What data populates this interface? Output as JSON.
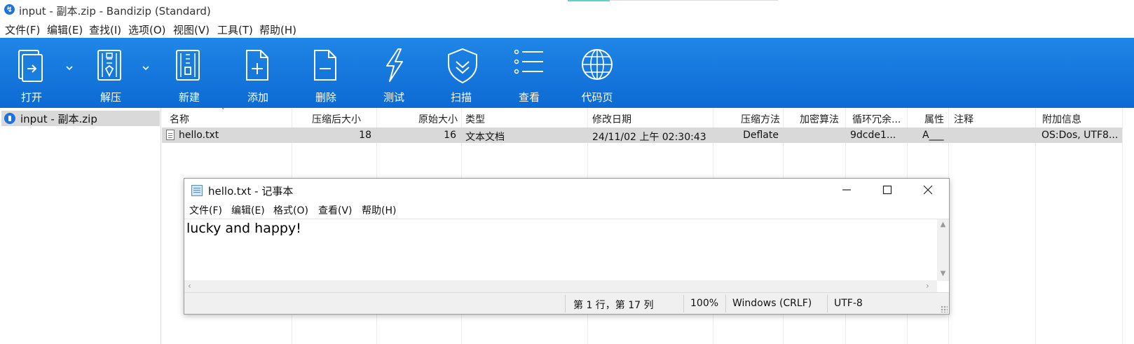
{
  "window": {
    "title": "input - 副本.zip - Bandizip (Standard)"
  },
  "menu": [
    "文件(F)",
    "编辑(E)",
    "查找(I)",
    "选项(O)",
    "视图(V)",
    "工具(T)",
    "帮助(H)"
  ],
  "toolbar": [
    {
      "label": "打开",
      "icon": "open-icon",
      "dropdown": true
    },
    {
      "label": "解压",
      "icon": "extract-icon",
      "dropdown": true
    },
    {
      "label": "新建",
      "icon": "new-archive-icon",
      "dropdown": false
    },
    {
      "label": "添加",
      "icon": "add-file-icon",
      "dropdown": false
    },
    {
      "label": "删除",
      "icon": "delete-file-icon",
      "dropdown": false
    },
    {
      "label": "测试",
      "icon": "test-icon",
      "dropdown": false
    },
    {
      "label": "扫描",
      "icon": "scan-shield-icon",
      "dropdown": false
    },
    {
      "label": "查看",
      "icon": "view-list-icon",
      "dropdown": false
    },
    {
      "label": "代码页",
      "icon": "codepage-globe-icon",
      "dropdown": false
    }
  ],
  "colors": {
    "toolbar_top": "#1f86e6",
    "toolbar_bottom": "#0d6ad4",
    "selection": "#d9d9d9"
  },
  "tree": {
    "item": "input - 副本.zip"
  },
  "columns": [
    "名称",
    "压缩后大小",
    "原始大小",
    "类型",
    "修改日期",
    "压缩方法",
    "加密算法",
    "循环冗余...",
    "属性",
    "注释",
    "附加信息"
  ],
  "files": [
    {
      "name": "hello.txt",
      "packed": "18",
      "size": "16",
      "type": "文本文档",
      "modified": "24/11/02 上午 02:30:43",
      "method": "Deflate",
      "encryption": "",
      "crc": "9dcde1...",
      "attributes": "A___",
      "comment": "",
      "extra": "OS:Dos, UTF8..."
    }
  ],
  "notepad": {
    "title": "hello.txt - 记事本",
    "menu": [
      "文件(F)",
      "编辑(E)",
      "格式(O)",
      "查看(V)",
      "帮助(H)"
    ],
    "content": "lucky and happy!",
    "status": {
      "position": "第 1 行，第 17 列",
      "zoom": "100%",
      "line_ending": "Windows (CRLF)",
      "encoding": "UTF-8"
    }
  }
}
